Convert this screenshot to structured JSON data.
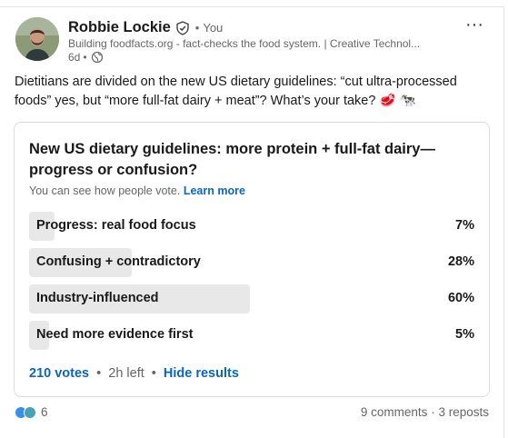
{
  "post": {
    "author_name": "Robbie Lockie",
    "you_label": "You",
    "dot": "•",
    "headline": "Building foodfacts.org - fact-checks the food system. | Creative Technol...",
    "age": "6d",
    "text": "Dietitians are divided on the new US dietary guidelines: “cut ultra-processed foods” yes, but “more full-fat dairy + meat”? What’s your take? 🥩 🐄",
    "more_label": "···"
  },
  "poll": {
    "question": "New US dietary guidelines: more protein + full-fat dairy—progress or confusion?",
    "visibility_text": "You can see how people vote.",
    "learn_more": "Learn more",
    "options": [
      {
        "label": "Progress: real food focus",
        "percent": "7%",
        "value": 7
      },
      {
        "label": "Confusing + contradictory",
        "percent": "28%",
        "value": 28
      },
      {
        "label": "Industry-influenced",
        "percent": "60%",
        "value": 60
      },
      {
        "label": "Need more evidence first",
        "percent": "5%",
        "value": 5
      }
    ],
    "votes": "210 votes",
    "time_left": "2h left",
    "dot": "•",
    "hide_results": "Hide results"
  },
  "social": {
    "reaction_icons": [
      "like-icon",
      "support-icon"
    ],
    "reaction_count": "6",
    "comments": "9 comments",
    "dot": "·",
    "reposts": "3 reposts"
  },
  "colors": {
    "link": "#0a66c2",
    "bar": "#e8e8e8",
    "like": "#378fe9"
  }
}
